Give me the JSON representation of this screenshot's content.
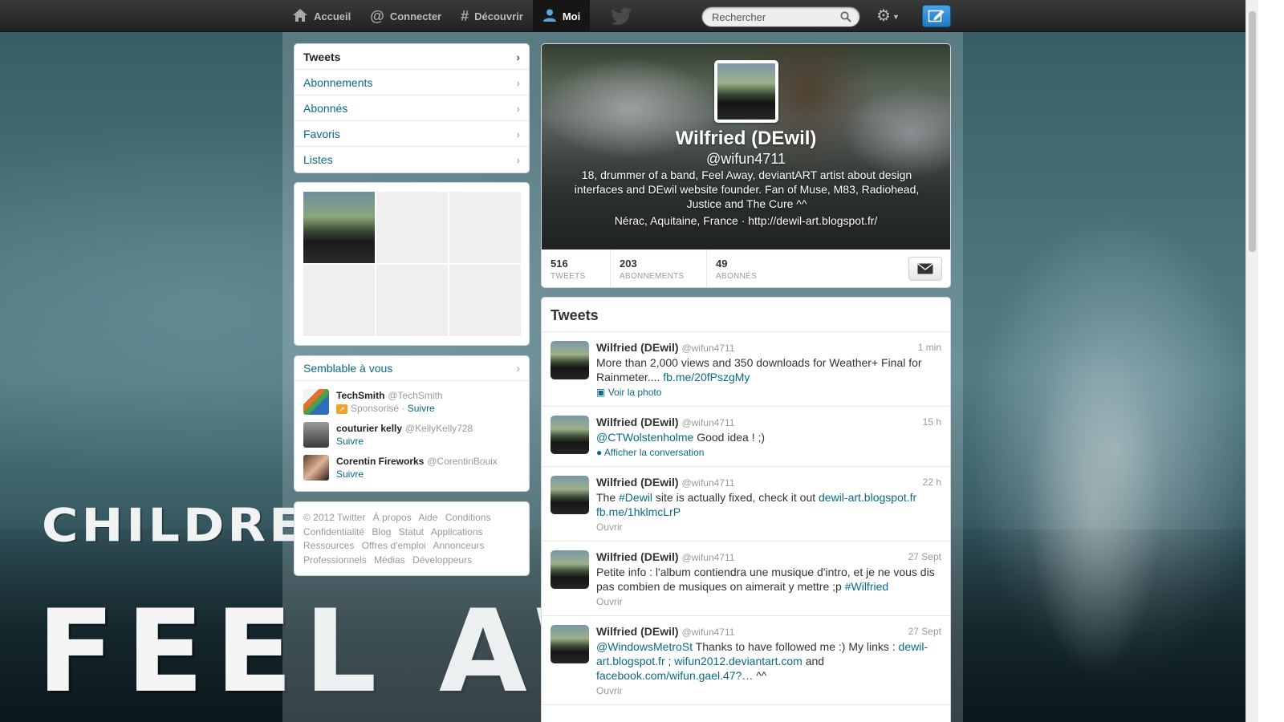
{
  "nav": {
    "home": "Accueil",
    "connect": "Connecter",
    "discover": "Découvrir",
    "me": "Moi"
  },
  "search": {
    "placeholder": "Rechercher"
  },
  "icons": {
    "home": "home-icon",
    "connect": "at-icon",
    "discover": "hash-icon",
    "me": "person-icon",
    "bird": "twitter-bird-icon",
    "search": "search-icon",
    "gear": "gear-icon",
    "compose": "compose-icon",
    "chevron": "chevron-right-icon",
    "dm": "envelope-icon"
  },
  "colors": {
    "accent": "#0a6a86",
    "topbar": "#222222",
    "compose": "#1f7ac2"
  },
  "sidebar": {
    "items": [
      {
        "label": "Tweets",
        "active": true
      },
      {
        "label": "Abonnements"
      },
      {
        "label": "Abonnés"
      },
      {
        "label": "Favoris"
      },
      {
        "label": "Listes"
      }
    ]
  },
  "who_to_follow": {
    "title": "Semblable à vous",
    "users": [
      {
        "name": "TechSmith",
        "handle": "@TechSmith",
        "sponsored": "Sponsorisé",
        "follow": "Suivre"
      },
      {
        "name": "couturier kelly",
        "handle": "@KellyKelly728",
        "follow": "Suivre"
      },
      {
        "name": "Corentin Fireworks",
        "handle": "@CorentinBouix",
        "follow": "Suivre"
      }
    ]
  },
  "footer": {
    "links": [
      "© 2012 Twitter",
      "À propos",
      "Aide",
      "Conditions",
      "Confidentialité",
      "Blog",
      "Statut",
      "Applications",
      "Ressources",
      "Offres d'emploi",
      "Annonceurs",
      "Professionnels",
      "Médias",
      "Développeurs"
    ]
  },
  "profile": {
    "name": "Wilfried (DEwil)",
    "screen_name": "@wifun4711",
    "bio": "18, drummer of a band, Feel Away, deviantART artist about design interfaces and DEwil website founder. Fan of Muse, M83, Radiohead, Justice and The Cure ^^",
    "location": "Nérac, Aquitaine, France",
    "separator": "·",
    "url": "http://dewil-art.blogspot.fr/",
    "stats": {
      "tweets": "516",
      "tweets_label": "TWEETS",
      "following": "203",
      "following_label": "ABONNEMENTS",
      "followers": "49",
      "followers_label": "ABONNÉS"
    }
  },
  "stream": {
    "title": "Tweets",
    "tweets": [
      {
        "name": "Wilfried (DEwil)",
        "handle": "@wifun4711",
        "time": "1 min",
        "text": "More than 2,000 views and 350 downloads for Weather+ Final for Rainmeter.... ",
        "link1": "fb.me/20fPszgMy",
        "action": "Voir la photo"
      },
      {
        "name": "Wilfried (DEwil)",
        "handle": "@wifun4711",
        "time": "15 h",
        "mention": "@CTWolstenholme",
        "text": " Good idea ! ;)",
        "action": "Afficher la conversation"
      },
      {
        "name": "Wilfried (DEwil)",
        "handle": "@wifun4711",
        "time": "22 h",
        "text_a": "The ",
        "hashtag": "#Dewil",
        "text_b": " site is actually fixed, check it out ",
        "link1": "dewil-art.blogspot.fr",
        "link2": "fb.me/1hklmcLrP",
        "action": "Ouvrir"
      },
      {
        "name": "Wilfried (DEwil)",
        "handle": "@wifun4711",
        "time": "27 Sept",
        "text": "Petite info : l'album contiendra une musique d'intro, et je ne vous dis pas combien de musiques on aimerait y mettre ;p ",
        "hashtag": "#Wilfried",
        "action": "Ouvrir"
      },
      {
        "name": "Wilfried (DEwil)",
        "handle": "@wifun4711",
        "time": "27 Sept",
        "mention": "@WindowsMetroSt",
        "text": " Thanks to have followed me :) My links : ",
        "link1": "dewil-art.blogspot.fr",
        "sep1": " ; ",
        "link2": "wifun2012.deviantart.com",
        "sep2": " and ",
        "link3": "facebook.com/wifun.gael.47?…",
        "tail": " ^^",
        "action": "Ouvrir"
      }
    ]
  },
  "background": {
    "band_subtitle": "CHILDREN S",
    "band_name": "FEEL AWA"
  }
}
